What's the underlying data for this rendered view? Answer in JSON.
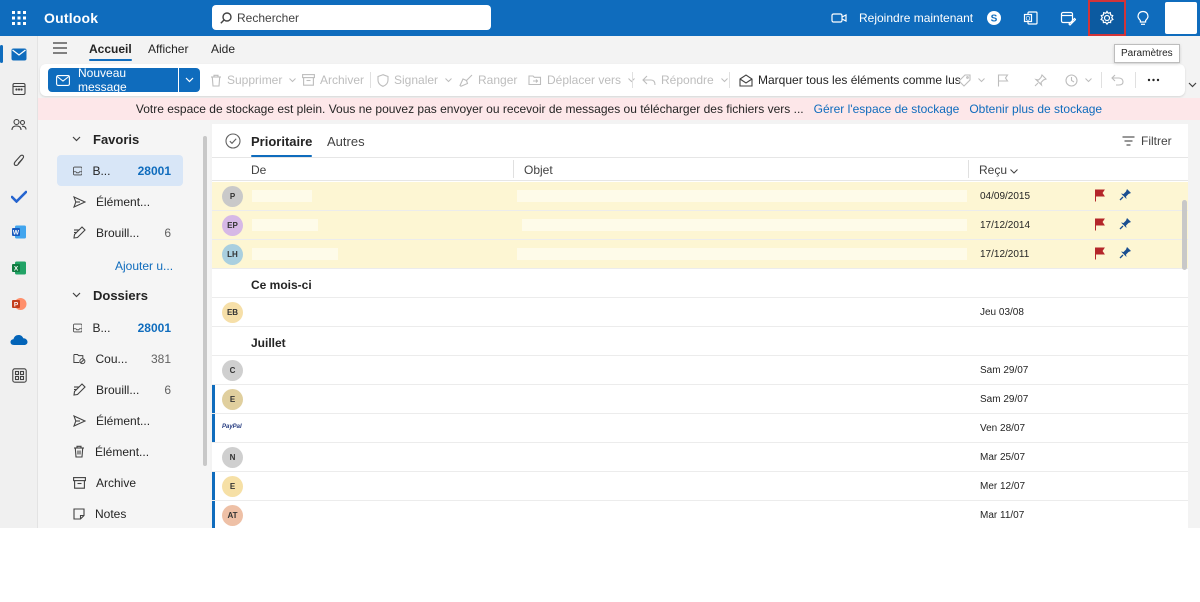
{
  "app": {
    "title": "Outlook"
  },
  "search": {
    "placeholder": "Rechercher"
  },
  "topbar": {
    "join_label": "Rejoindre maintenant",
    "tooltip": "Paramètres"
  },
  "tabs": [
    {
      "label": "Accueil",
      "active": true
    },
    {
      "label": "Afficher",
      "active": false
    },
    {
      "label": "Aide",
      "active": false
    }
  ],
  "ribbon": {
    "new_message": "Nouveau message",
    "delete": "Supprimer",
    "archive": "Archiver",
    "report": "Signaler",
    "sweep": "Ranger",
    "move_to": "Déplacer vers",
    "reply": "Répondre",
    "mark_all_read": "Marquer tous les éléments comme lus"
  },
  "banner": {
    "message": "Votre espace de stockage est plein. Vous ne pouvez pas envoyer ou recevoir de messages ou télécharger des fichiers vers ...",
    "link_manage": "Gérer l'espace de stockage",
    "link_more": "Obtenir plus de stockage"
  },
  "folders": {
    "favorites_label": "Favoris",
    "favorites": [
      {
        "name": "B...",
        "count": "28001",
        "icon": "inbox-icon"
      },
      {
        "name": "Élément...",
        "count": "",
        "icon": "send-icon"
      },
      {
        "name": "Brouill...",
        "count": "6",
        "icon": "draft-icon"
      }
    ],
    "add_favorite": "Ajouter u...",
    "folders_label": "Dossiers",
    "folders": [
      {
        "name": "B...",
        "count": "28001",
        "icon": "inbox-icon"
      },
      {
        "name": "Cou...",
        "count": "381",
        "icon": "junk-icon"
      },
      {
        "name": "Brouill...",
        "count": "6",
        "icon": "draft-icon"
      },
      {
        "name": "Élément...",
        "count": "",
        "icon": "send-icon"
      },
      {
        "name": "Élément...",
        "count": "",
        "icon": "trash-icon"
      },
      {
        "name": "Archive",
        "count": "",
        "icon": "archive-icon"
      },
      {
        "name": "Notes",
        "count": "",
        "icon": "note-icon"
      }
    ]
  },
  "list": {
    "pivot_focused": "Prioritaire",
    "pivot_other": "Autres",
    "filter": "Filtrer",
    "col_from": "De",
    "col_subject": "Objet",
    "col_received": "Reçu",
    "pinned": [
      {
        "initials": "P",
        "color": "#c9c9c9",
        "date": "04/09/2015"
      },
      {
        "initials": "EP",
        "color": "#d6b8e6",
        "date": "17/12/2014"
      },
      {
        "initials": "LH",
        "color": "#a9cfdf",
        "date": "17/12/2011"
      }
    ],
    "group_month": "Ce mois-ci",
    "month_rows": [
      {
        "initials": "EB",
        "color": "#f6dfa8",
        "date": "Jeu 03/08",
        "unread": false
      }
    ],
    "group_july": "Juillet",
    "july_rows": [
      {
        "initials": "C",
        "color": "#cfcfcf",
        "date": "Sam 29/07",
        "unread": false
      },
      {
        "initials": "E",
        "color": "#e0cf9e",
        "date": "Sam 29/07",
        "unread": true
      },
      {
        "initials": "PayPal",
        "color": "#ffffff",
        "date": "Ven 28/07",
        "unread": true
      },
      {
        "initials": "N",
        "color": "#cfcfcf",
        "date": "Mar 25/07",
        "unread": false
      },
      {
        "initials": "E",
        "color": "#f6e0a6",
        "date": "Mer 12/07",
        "unread": true
      },
      {
        "initials": "AT",
        "color": "#eec0a6",
        "date": "Mar 11/07",
        "unread": true
      }
    ]
  },
  "colors": {
    "brand": "#0f6cbd",
    "banner_bg": "#fde7e9",
    "pinned_bg": "#fdf6d3",
    "flag": "#b4262a"
  }
}
